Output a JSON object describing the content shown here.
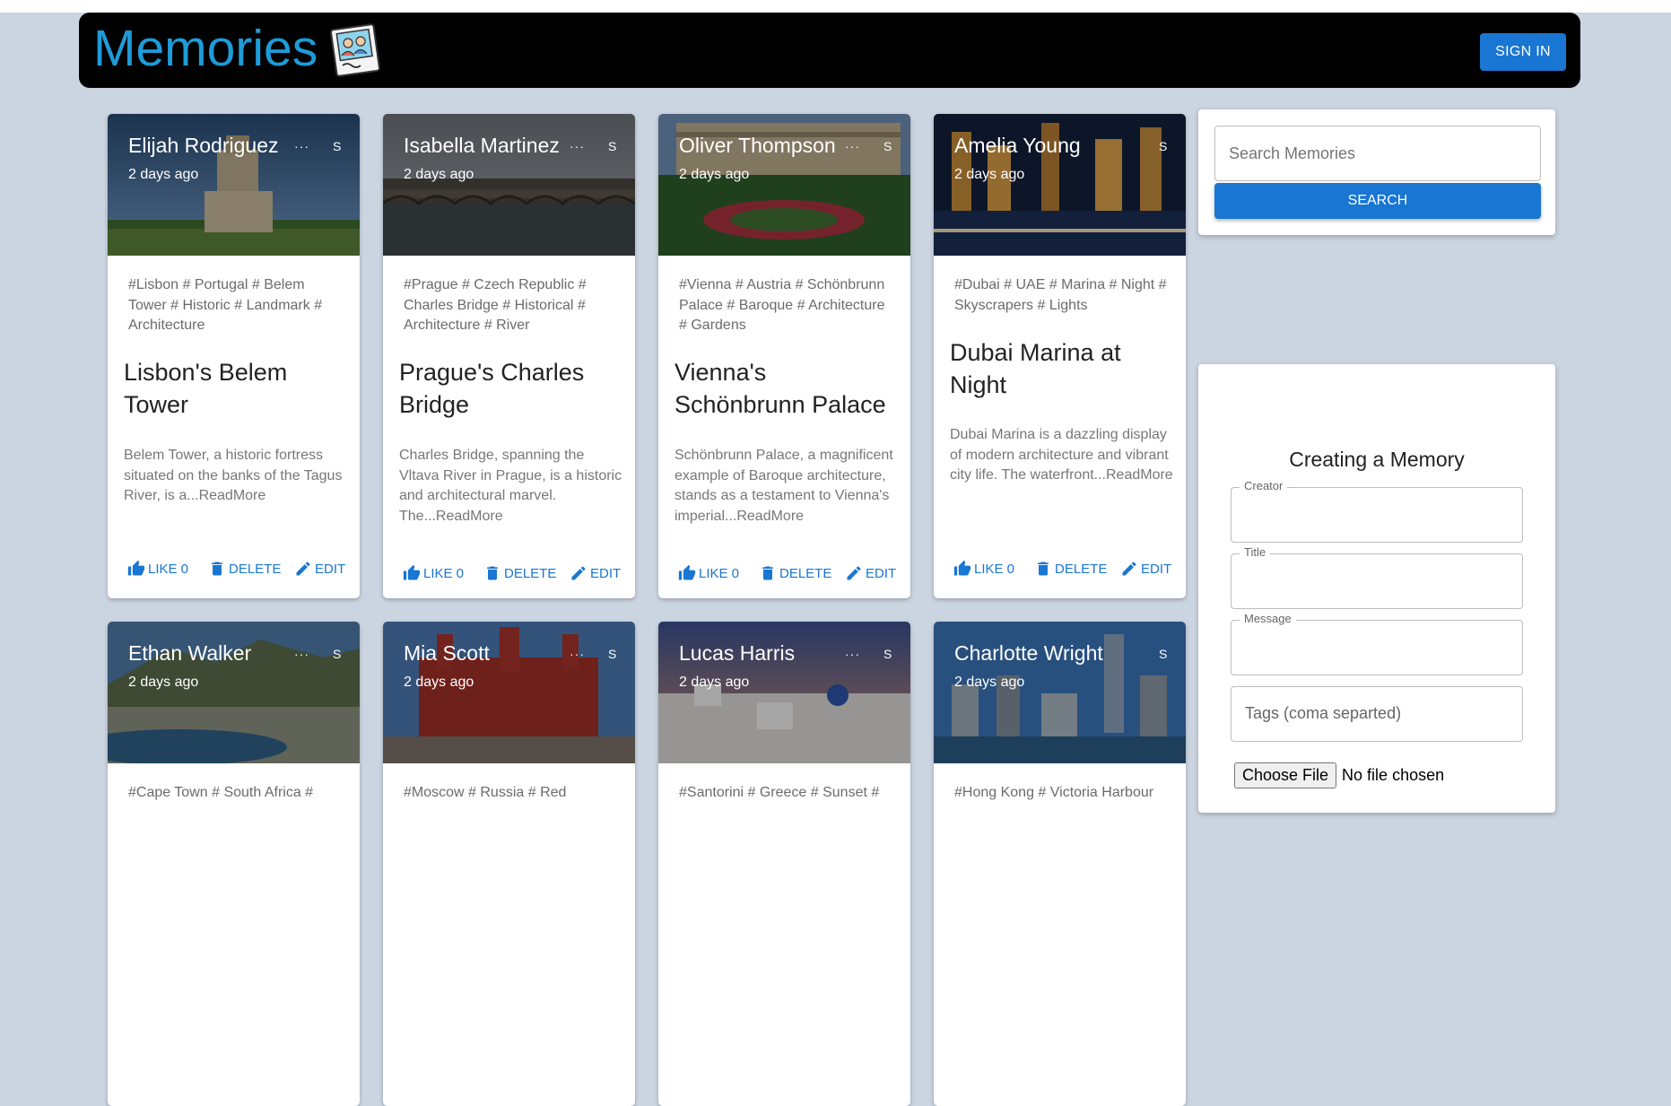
{
  "app": {
    "title": "Memories",
    "signin_label": "SIGN IN"
  },
  "cards": [
    {
      "creator": "Elijah Rodriguez",
      "time": "2 days ago",
      "more": "···",
      "s": "S",
      "tags": "#Lisbon # Portugal # Belem Tower # Historic # Landmark # Architecture",
      "title": "Lisbon's Belem Tower",
      "message": "Belem Tower, a historic fortress situated on the banks of the Tagus River, is a...ReadMore",
      "like": "LIKE 0",
      "delete": "DELETE",
      "edit": "EDIT"
    },
    {
      "creator": "Isabella Martinez",
      "time": "2 days ago",
      "more": "···",
      "s": "S",
      "tags": "#Prague # Czech Republic # Charles Bridge # Historical # Architecture # River",
      "title": "Prague's Charles Bridge",
      "message": "Charles Bridge, spanning the Vltava River in Prague, is a historic and architectural marvel. The...ReadMore",
      "like": "LIKE 0",
      "delete": "DELETE",
      "edit": "EDIT"
    },
    {
      "creator": "Oliver Thompson",
      "time": "2 days ago",
      "more": "···",
      "s": "S",
      "tags": "#Vienna # Austria # Schönbrunn Palace # Baroque # Architecture # Gardens",
      "title": "Vienna's Schönbrunn Palace",
      "message": "Schönbrunn Palace, a magnificent example of Baroque architecture, stands as a testament to Vienna's imperial...ReadMore",
      "like": "LIKE 0",
      "delete": "DELETE",
      "edit": "EDIT"
    },
    {
      "creator": "Amelia Young",
      "time": "2 days ago",
      "more": "···",
      "s": "S",
      "tags": "#Dubai # UAE # Marina # Night # Skyscrapers # Lights",
      "title": "Dubai Marina at Night",
      "message": "Dubai Marina is a dazzling display of modern architecture and vibrant city life. The waterfront...ReadMore",
      "like": "LIKE 0",
      "delete": "DELETE",
      "edit": "EDIT"
    },
    {
      "creator": "Ethan Walker",
      "time": "2 days ago",
      "more": "···",
      "s": "S",
      "tags": "#Cape Town # South Africa #",
      "title": "",
      "message": "",
      "like": "",
      "delete": "",
      "edit": ""
    },
    {
      "creator": "Mia Scott",
      "time": "2 days ago",
      "more": "···",
      "s": "S",
      "tags": "#Moscow # Russia # Red",
      "title": "",
      "message": "",
      "like": "",
      "delete": "",
      "edit": ""
    },
    {
      "creator": "Lucas Harris",
      "time": "2 days ago",
      "more": "···",
      "s": "S",
      "tags": "#Santorini # Greece # Sunset #",
      "title": "",
      "message": "",
      "like": "",
      "delete": "",
      "edit": ""
    },
    {
      "creator": "Charlotte Wright",
      "time": "2 days ago",
      "more": "···",
      "s": "S",
      "tags": "#Hong Kong # Victoria Harbour",
      "title": "",
      "message": "",
      "like": "",
      "delete": "",
      "edit": ""
    }
  ],
  "search": {
    "placeholder": "Search Memories",
    "button": "SEARCH"
  },
  "form": {
    "title": "Creating a Memory",
    "creator_label": "Creator",
    "title_label": "Title",
    "message_label": "Message",
    "tags_placeholder": "Tags (coma separted)",
    "file_button": "Choose File",
    "file_status": "No file chosen"
  },
  "colors": {
    "background": "#cbd5e1",
    "appbar": "#000000",
    "accent": "#1976d2",
    "title": "#1e9bd9"
  }
}
